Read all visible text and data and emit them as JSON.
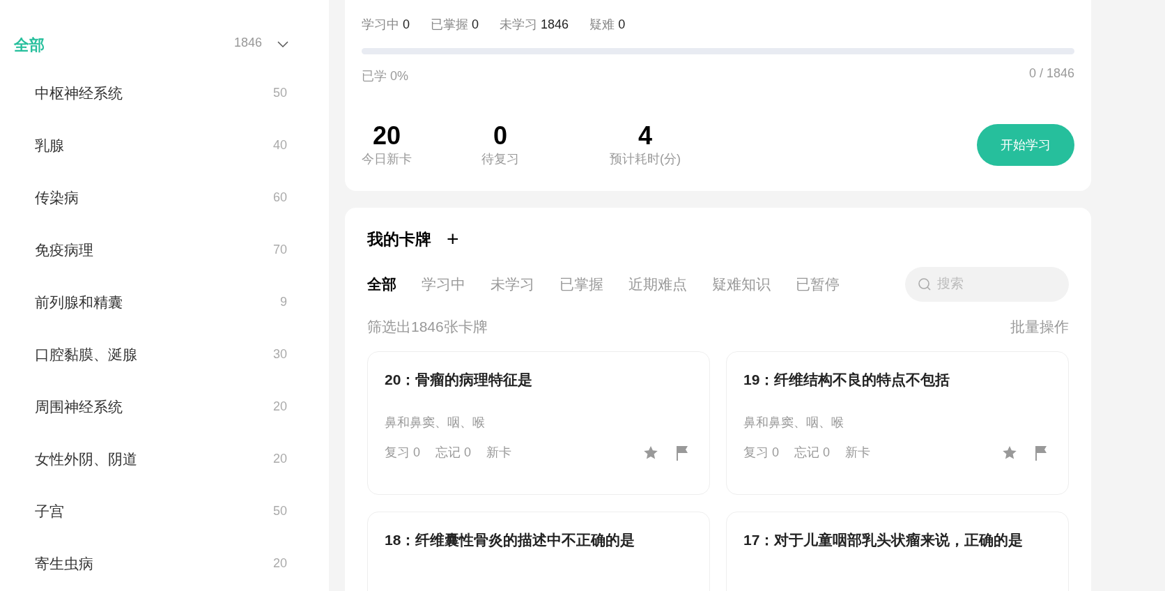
{
  "sidebar": {
    "header": {
      "label": "全部",
      "count": "1846",
      "selected": true,
      "expanded": true
    },
    "items": [
      {
        "label": "中枢神经系统",
        "count": "50",
        "selected": false
      },
      {
        "label": "乳腺",
        "count": "40",
        "selected": false
      },
      {
        "label": "传染病",
        "count": "60",
        "selected": false
      },
      {
        "label": "免疫病理",
        "count": "70",
        "selected": false
      },
      {
        "label": "前列腺和精囊",
        "count": "9",
        "selected": false
      },
      {
        "label": "口腔黏膜、涎腺",
        "count": "30",
        "selected": false
      },
      {
        "label": "周围神经系统",
        "count": "20",
        "selected": false
      },
      {
        "label": "女性外阴、阴道",
        "count": "20",
        "selected": false
      },
      {
        "label": "子宫",
        "count": "50",
        "selected": false
      },
      {
        "label": "寄生虫病",
        "count": "20",
        "selected": false
      }
    ]
  },
  "progress": {
    "stats": [
      {
        "label": "学习中",
        "value": "0"
      },
      {
        "label": "已掌握",
        "value": "0"
      },
      {
        "label": "未学习",
        "value": "1846"
      },
      {
        "label": "疑难",
        "value": "0"
      }
    ],
    "level": 0,
    "learned": "已学 0%",
    "fraction": "0 / 1846",
    "today": [
      {
        "value": "20",
        "label": "今日新卡"
      },
      {
        "value": "0",
        "label": "待复习"
      },
      {
        "value": "4",
        "label": "预计耗时(分)"
      }
    ],
    "start_button": "开始学习"
  },
  "deck": {
    "title": "我的卡牌",
    "add_button": "+",
    "tabs": [
      {
        "label": "全部",
        "selected": true
      },
      {
        "label": "学习中",
        "selected": false
      },
      {
        "label": "未学习",
        "selected": false
      },
      {
        "label": "已掌握",
        "selected": false
      },
      {
        "label": "近期难点",
        "selected": false
      },
      {
        "label": "疑难知识",
        "selected": false
      },
      {
        "label": "已暂停",
        "selected": false
      }
    ],
    "search": {
      "placeholder": "搜索"
    },
    "filter_summary": "筛选出1846张卡牌",
    "batch_button": "批量操作",
    "cards": [
      {
        "title": "20：骨瘤的病理特征是",
        "tag": "鼻和鼻窦、咽、喉",
        "review": "复习 0",
        "forget": "忘记 0",
        "status": "新卡"
      },
      {
        "title": "19：纤维结构不良的特点不包括",
        "tag": "鼻和鼻窦、咽、喉",
        "review": "复习 0",
        "forget": "忘记 0",
        "status": "新卡"
      },
      {
        "title": "18：纤维囊性骨炎的描述中不正确的是"
      },
      {
        "title": "17：对于儿童咽部乳头状瘤来说，正确的是"
      }
    ]
  }
}
